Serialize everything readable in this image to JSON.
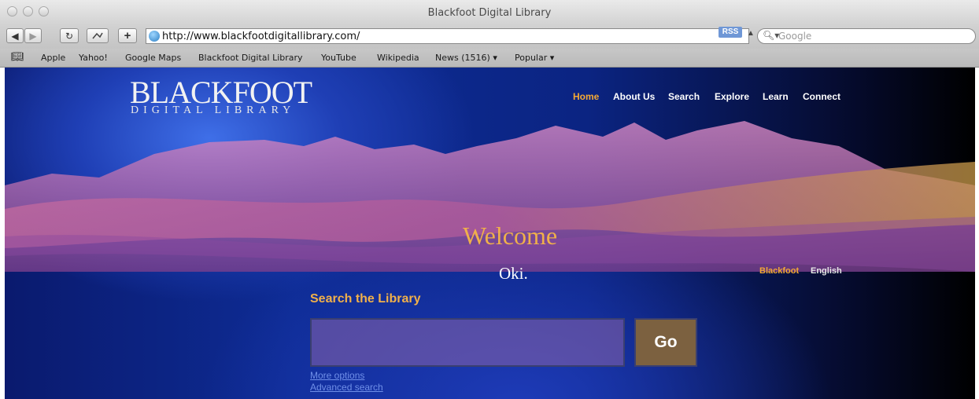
{
  "window": {
    "title": "Blackfoot Digital Library"
  },
  "toolbar": {
    "back_icon": "back-arrow-icon",
    "forward_icon": "forward-arrow-icon",
    "reload_icon": "reload-icon",
    "add_bookmark_label": "+",
    "url": "http://www.blackfootdigitallibrary.com/",
    "rss_label": "RSS",
    "search_placeholder": "Google"
  },
  "bookmarks": {
    "items": [
      "Apple",
      "Yahoo!",
      "Google Maps",
      "Blackfoot Digital Library",
      "YouTube",
      "Wikipedia",
      "News (1516)",
      "Popular"
    ]
  },
  "site": {
    "logo_main": "BLACKFOOT",
    "logo_sub": "DIGITAL LIBRARY",
    "nav": [
      "Home",
      "About Us",
      "Search",
      "Explore",
      "Learn",
      "Connect"
    ],
    "active_nav": "Home",
    "welcome": "Welcome",
    "greeting": "Oki.",
    "languages": [
      "Blackfoot",
      "English"
    ],
    "active_language": "Blackfoot",
    "search_heading": "Search the Library",
    "search_value": "",
    "go_label": "Go",
    "more_options": "More options",
    "advanced_search": "Advanced search"
  },
  "colors": {
    "accent": "#f0b04a",
    "page_background": "#0e2c95",
    "link": "#6f8fe8"
  }
}
